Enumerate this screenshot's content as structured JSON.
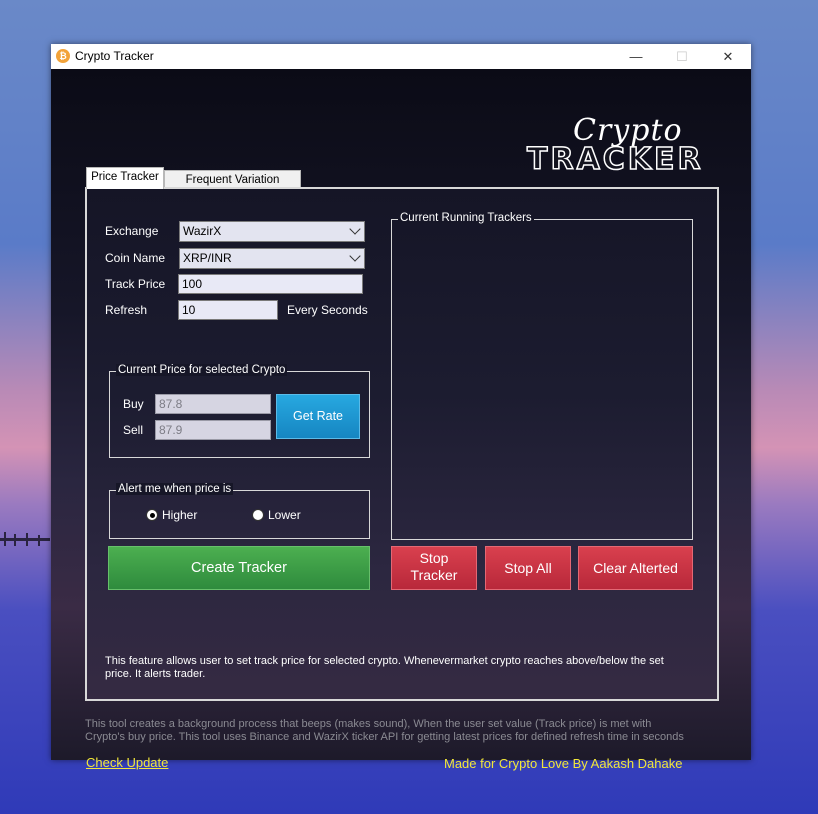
{
  "window": {
    "title": "Crypto Tracker",
    "minimize": "—",
    "maximize": "☐",
    "close": "✕"
  },
  "logo": {
    "line1": "Crypto",
    "line2": "TRACKER"
  },
  "tabs": [
    {
      "label": "Price Tracker",
      "active": true
    },
    {
      "label": "Frequent Variation Tracker",
      "active": false
    }
  ],
  "form": {
    "exchange_label": "Exchange",
    "exchange_value": "WazirX",
    "coin_label": "Coin Name",
    "coin_value": "XRP/INR",
    "track_label": "Track Price",
    "track_value": "100",
    "refresh_label": "Refresh",
    "refresh_value": "10",
    "refresh_suffix": "Every Seconds"
  },
  "current_price": {
    "title": "Current Price for selected Crypto",
    "buy_label": "Buy",
    "buy_value": "87.8",
    "sell_label": "Sell",
    "sell_value": "87.9",
    "get_rate": "Get Rate"
  },
  "alert": {
    "title": "Alert me when price is",
    "higher": "Higher",
    "lower": "Lower",
    "selected": "Higher"
  },
  "trackers": {
    "title": "Current Running Trackers"
  },
  "buttons": {
    "create": "Create Tracker",
    "stop_line1": "Stop",
    "stop_line2": "Tracker",
    "stop_all": "Stop All",
    "clear": "Clear Alterted"
  },
  "description": "This feature allows user to set track price for selected crypto. Whenevermarket crypto reaches above/below the set price. It alerts trader.",
  "footer": {
    "description": "This tool creates a background process that beeps (makes sound), When the user set value (Track price) is met with Crypto's buy price. This tool uses Binance and WazirX ticker API for getting latest prices for defined refresh time in seconds",
    "check_update": "Check Update",
    "credit": "Made for Crypto Love By Aakash Dahake"
  }
}
